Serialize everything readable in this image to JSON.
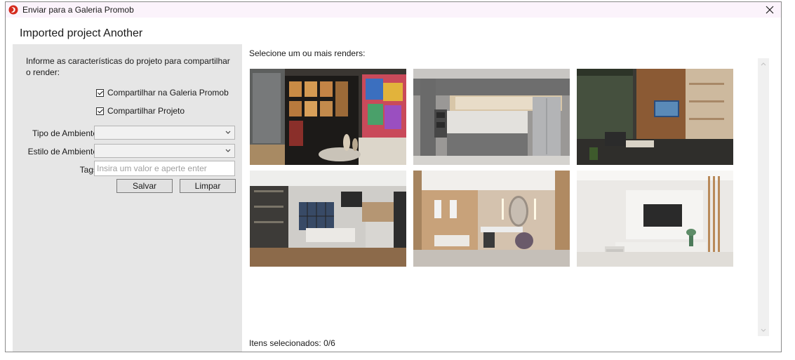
{
  "window": {
    "title": "Enviar para a Galeria Promob",
    "close_icon": "close-icon",
    "app_icon": "promob-logo-icon"
  },
  "project_title": "Imported project Another",
  "form": {
    "info_text": "Informe as características do projeto para compartilhar o render:",
    "share_gallery_label": "Compartilhar na Galeria Promob",
    "share_gallery_checked": true,
    "share_project_label": "Compartilhar Projeto",
    "share_project_checked": true,
    "ambient_type_label": "Tipo de Ambiente",
    "ambient_type_value": "",
    "ambient_style_label": "Estilo de Ambiente",
    "ambient_style_value": "",
    "tags_label": "Tags",
    "tags_placeholder": "Insira um valor e aperte enter",
    "save_label": "Salvar",
    "clear_label": "Limpar"
  },
  "renders": {
    "header": "Selecione um ou mais renders:",
    "items": [
      {
        "name": "render-1",
        "description": "kitchen with illuminated shelves and colorful painting"
      },
      {
        "name": "render-2",
        "description": "gray kitchen with wood backsplash and stainless fridge"
      },
      {
        "name": "render-3",
        "description": "living room with wooden panel and TV"
      },
      {
        "name": "render-4",
        "description": "open kitchen and dining with large window"
      },
      {
        "name": "render-5",
        "description": "hallway with vanity, round mirror and coat hooks"
      },
      {
        "name": "render-6",
        "description": "white living room with TV panel and sideboard"
      }
    ],
    "status": "Itens selecionados: 0/6"
  },
  "colors": {
    "titlebar": "#fbf3fb",
    "panel": "#e6e6e6",
    "accent": "#d52b1e"
  }
}
